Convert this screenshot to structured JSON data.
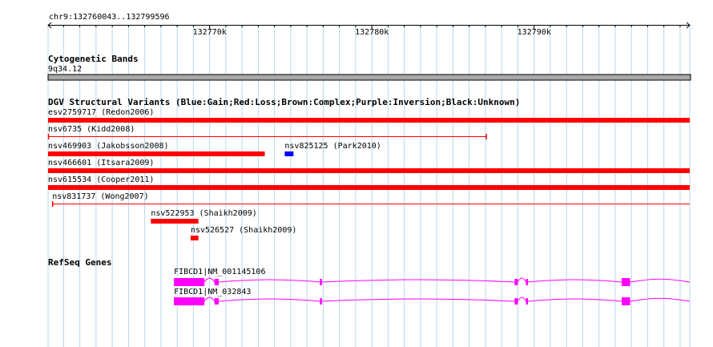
{
  "ruler": {
    "chrom": "chr9",
    "start": 132760043,
    "end": 132799596,
    "label": "chr9:132760043..132799596",
    "ticks": [
      {
        "pos": 132770000,
        "label": "132770k"
      },
      {
        "pos": 132780000,
        "label": "132780k"
      },
      {
        "pos": 132790000,
        "label": "132790k"
      }
    ]
  },
  "cytoband": {
    "title": "Cytogenetic Bands",
    "band": "9q34.12"
  },
  "dgv": {
    "title": "DGV Structural Variants (Blue:Gain;Red:Loss;Brown:Complex;Purple:Inversion;Black:Unknown)",
    "variants": [
      {
        "id": "v1",
        "label": "esv2759717 (Redon2006)",
        "start": 132760043,
        "end": 132799596,
        "style": "bar",
        "color": "#ff0000"
      },
      {
        "id": "v2",
        "label": "nsv6735 (Kidd2008)",
        "start": 132760043,
        "end": 132787080,
        "style": "line",
        "color": "#ff0000"
      },
      {
        "id": "v3",
        "label": "nsv469903 (Jakobsson2008)",
        "start": 132760043,
        "end": 132773400,
        "style": "bar",
        "color": "#ff0000"
      },
      {
        "id": "v4",
        "label": "nsv825125 (Park2010)",
        "start": 132774630,
        "end": 132775170,
        "style": "bar",
        "color": "#0000ff"
      },
      {
        "id": "v5",
        "label": "nsv466601 (Itsara2009)",
        "start": 132760043,
        "end": 132799596,
        "style": "bar",
        "color": "#ff0000"
      },
      {
        "id": "v6",
        "label": "nsv615534 (Cooper2011)",
        "start": 132760043,
        "end": 132799596,
        "style": "bar",
        "color": "#ff0000"
      },
      {
        "id": "v7",
        "label": "nsv831737 (Wong2007)",
        "start": 132760300,
        "end": 132799596,
        "style": "line",
        "color": "#ff0000"
      },
      {
        "id": "v8",
        "label": "nsv522953 (Shaikh2009)",
        "start": 132766380,
        "end": 132769310,
        "style": "bar",
        "color": "#ff0000"
      },
      {
        "id": "v9",
        "label": "nsv526527 (Shaikh2009)",
        "start": 132768830,
        "end": 132769310,
        "style": "bar",
        "color": "#ff0000"
      }
    ]
  },
  "refseq": {
    "title": "RefSeq Genes",
    "color": "#ff00ff",
    "transcripts": [
      {
        "label": "FIBCD1|NM_001145106",
        "start": 132767800,
        "end": 132799596,
        "exons": [
          [
            132767800,
            132769680
          ],
          [
            132770300,
            132770560
          ],
          [
            132776800,
            132776900
          ],
          [
            132788800,
            132789000
          ],
          [
            132789500,
            132789620
          ],
          [
            132795400,
            132795920
          ]
        ],
        "thick": [
          [
            132767800,
            132769680
          ],
          [
            132795400,
            132795920
          ]
        ]
      },
      {
        "label": "FIBCD1|NM_032843",
        "start": 132767800,
        "end": 132799596,
        "exons": [
          [
            132767800,
            132769680
          ],
          [
            132770300,
            132770560
          ],
          [
            132776800,
            132776900
          ],
          [
            132788800,
            132789000
          ],
          [
            132789500,
            132789620
          ],
          [
            132795400,
            132795920
          ]
        ],
        "thick": [
          [
            132767800,
            132769680
          ],
          [
            132795400,
            132795920
          ]
        ]
      }
    ]
  }
}
